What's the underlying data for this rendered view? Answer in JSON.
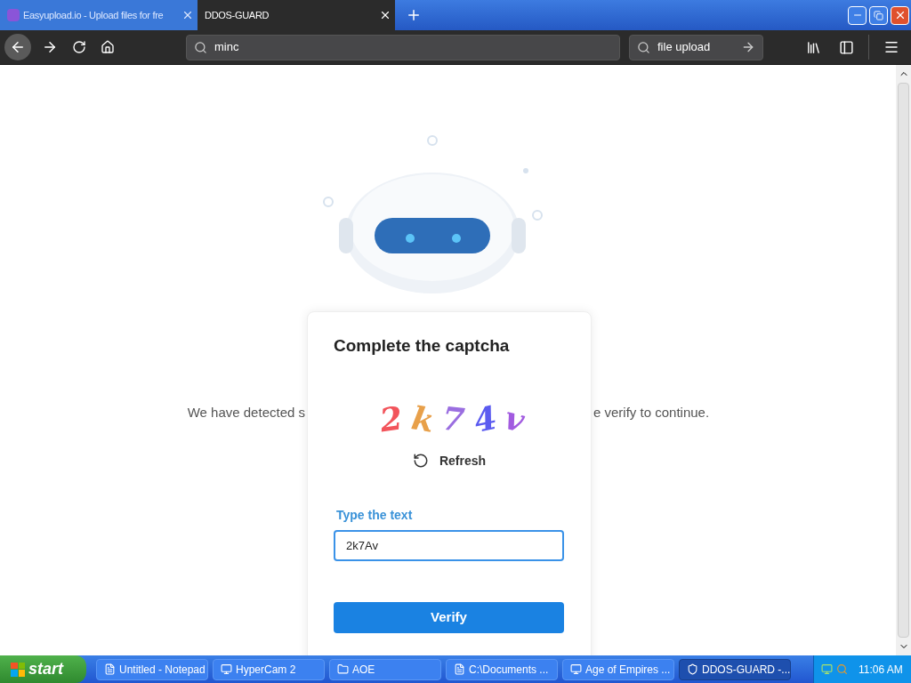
{
  "browser": {
    "tabs": [
      {
        "title": "Easyupload.io - Upload files for fre",
        "selected": false
      },
      {
        "title": "DDOS-GUARD",
        "selected": true
      }
    ],
    "address": "minc",
    "search": "file upload"
  },
  "page": {
    "background_text": [
      "We have detected s",
      "e verify to continue."
    ],
    "card": {
      "title": "Complete the captcha",
      "captcha": [
        {
          "char": "2",
          "color": "#f2545b"
        },
        {
          "char": "k",
          "color": "#e8a04a"
        },
        {
          "char": "7",
          "color": "#9a6ee0"
        },
        {
          "char": "4",
          "color": "#5b5bf0"
        },
        {
          "char": "v",
          "color": "#a25be0"
        }
      ],
      "refresh": "Refresh",
      "field_label": "Type the text",
      "field_value": "2k7Av",
      "button": "Verify"
    }
  },
  "taskbar": {
    "start": "start",
    "items": [
      {
        "label": "Untitled - Notepad",
        "selected": false
      },
      {
        "label": "HyperCam 2",
        "selected": false
      },
      {
        "label": "AOE",
        "selected": false
      },
      {
        "label": "C:\\Documents ...",
        "selected": false
      },
      {
        "label": "Age of Empires ...",
        "selected": false
      },
      {
        "label": "DDOS-GUARD -...",
        "selected": true
      }
    ],
    "clock": "11:06 AM"
  }
}
